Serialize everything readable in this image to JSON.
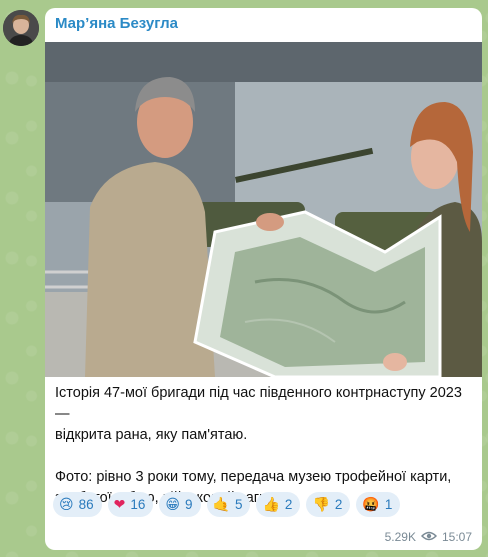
{
  "channel": {
    "author_name": "Мар’яна Безугла"
  },
  "message": {
    "line1": "Історія 47-мої бригади під час південного контрнаступу 2023 —",
    "line2": "відкрита рана, яку пам'ятаю.",
    "line3": "Фото: рівно 3 роки тому, передача музею трофейної карти,",
    "line4": "здобутої в бою, військовий загинув."
  },
  "reactions": [
    {
      "icon": "crying-face-icon",
      "emoji": "😢",
      "count": "86"
    },
    {
      "icon": "red-heart-icon",
      "emoji": "❤",
      "count": "16"
    },
    {
      "icon": "grinning-face-icon",
      "emoji": "😁",
      "count": "9"
    },
    {
      "icon": "hand-icon",
      "emoji": "🤙",
      "count": "5"
    },
    {
      "icon": "thumbs-up-icon",
      "emoji": "👍",
      "count": "2"
    },
    {
      "icon": "thumbs-down-icon",
      "emoji": "👎",
      "count": "2"
    },
    {
      "icon": "angry-face-icon",
      "emoji": "🤬",
      "count": "1"
    }
  ],
  "meta": {
    "views": "5.29K",
    "time": "15:07"
  },
  "colors": {
    "accent": "#2b8ac6",
    "background": "#a9c98d"
  }
}
